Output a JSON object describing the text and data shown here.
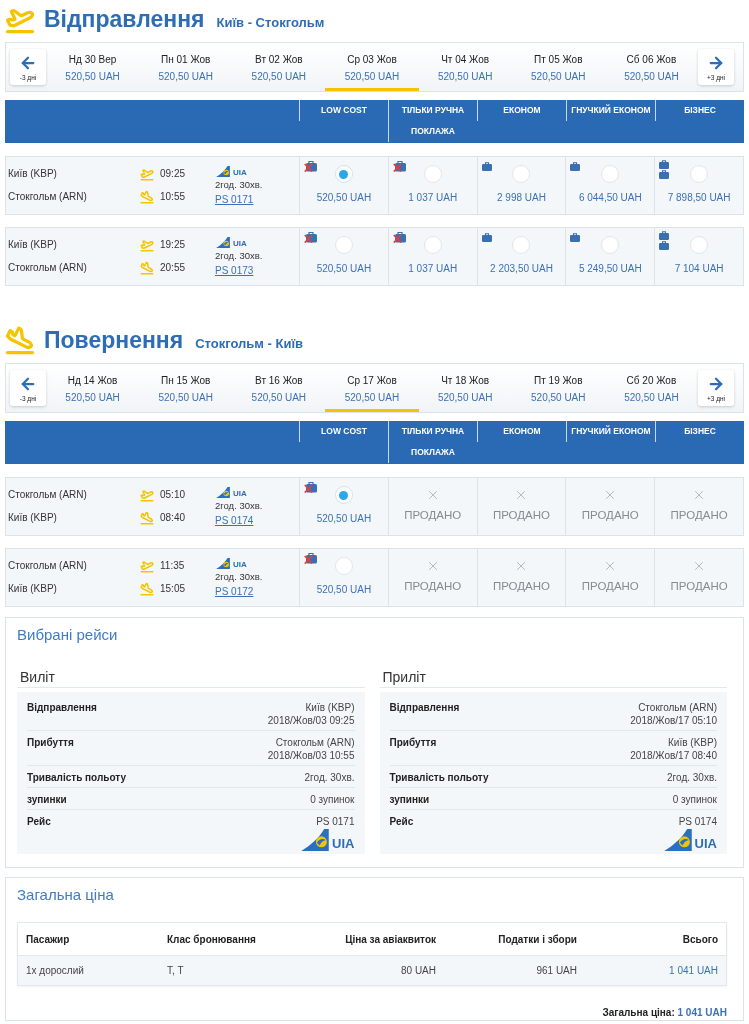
{
  "legs": [
    {
      "kind": "departure",
      "title": "Відправлення",
      "route": "Київ - Стокгольм",
      "date_nav": {
        "prev_label": "-3 дні",
        "next_label": "+3 дні",
        "days": [
          {
            "day": "Нд 30 Вер",
            "price": "520,50 UAH",
            "selected": false
          },
          {
            "day": "Пн 01 Жов",
            "price": "520,50 UAH",
            "selected": false
          },
          {
            "day": "Вт 02 Жов",
            "price": "520,50 UAH",
            "selected": false
          },
          {
            "day": "Ср 03 Жов",
            "price": "520,50 UAH",
            "selected": true
          },
          {
            "day": "Чт 04 Жов",
            "price": "520,50 UAH",
            "selected": false
          },
          {
            "day": "Пт 05 Жов",
            "price": "520,50 UAH",
            "selected": false
          },
          {
            "day": "Сб 06 Жов",
            "price": "520,50 UAH",
            "selected": false
          }
        ]
      },
      "fare_columns": [
        "LOW COST",
        "ТІЛЬКИ РУЧНА ПОКЛАЖА",
        "ЕКОНОМ",
        "ГНУЧКИЙ ЕКОНОМ",
        "БІЗНЕС"
      ],
      "flights": [
        {
          "from": "Київ (KBP)",
          "departure_time": "09:25",
          "to": "Стокгольм (ARN)",
          "arrival_time": "10:55",
          "airline": "UIA",
          "duration": "2год. 30хв.",
          "flight_number": "PS 0171",
          "fares": [
            {
              "kind": "no_bag",
              "price": "520,50 UAH",
              "selected": true
            },
            {
              "kind": "no_bag",
              "price": "1 037 UAH",
              "selected": false
            },
            {
              "kind": "one_bag",
              "price": "2 998 UAH",
              "selected": false
            },
            {
              "kind": "one_bag",
              "price": "6 044,50 UAH",
              "selected": false
            },
            {
              "kind": "two_bags",
              "price": "7 898,50 UAH",
              "selected": false
            }
          ]
        },
        {
          "from": "Київ (KBP)",
          "departure_time": "19:25",
          "to": "Стокгольм (ARN)",
          "arrival_time": "20:55",
          "airline": "UIA",
          "duration": "2год. 30хв.",
          "flight_number": "PS 0173",
          "fares": [
            {
              "kind": "no_bag",
              "price": "520,50 UAH",
              "selected": false
            },
            {
              "kind": "no_bag",
              "price": "1 037 UAH",
              "selected": false
            },
            {
              "kind": "one_bag",
              "price": "2 203,50 UAH",
              "selected": false
            },
            {
              "kind": "one_bag",
              "price": "5 249,50 UAH",
              "selected": false
            },
            {
              "kind": "two_bags",
              "price": "7 104 UAH",
              "selected": false
            }
          ]
        }
      ]
    },
    {
      "kind": "return",
      "title": "Повернення",
      "route": "Стокгольм - Київ",
      "date_nav": {
        "prev_label": "-3 дні",
        "next_label": "+3 дні",
        "days": [
          {
            "day": "Нд 14 Жов",
            "price": "520,50 UAH",
            "selected": false
          },
          {
            "day": "Пн 15 Жов",
            "price": "520,50 UAH",
            "selected": false
          },
          {
            "day": "Вт 16 Жов",
            "price": "520,50 UAH",
            "selected": false
          },
          {
            "day": "Ср 17 Жов",
            "price": "520,50 UAH",
            "selected": true
          },
          {
            "day": "Чт 18 Жов",
            "price": "520,50 UAH",
            "selected": false
          },
          {
            "day": "Пт 19 Жов",
            "price": "520,50 UAH",
            "selected": false
          },
          {
            "day": "Сб 20 Жов",
            "price": "520,50 UAH",
            "selected": false
          }
        ]
      },
      "fare_columns": [
        "LOW COST",
        "ТІЛЬКИ РУЧНА ПОКЛАЖА",
        "ЕКОНОМ",
        "ГНУЧКИЙ ЕКОНОМ",
        "БІЗНЕС"
      ],
      "flights": [
        {
          "from": "Стокгольм (ARN)",
          "departure_time": "05:10",
          "to": "Київ (KBP)",
          "arrival_time": "08:40",
          "airline": "UIA",
          "duration": "2год. 30хв.",
          "flight_number": "PS 0174",
          "fares": [
            {
              "kind": "no_bag",
              "price": "520,50 UAH",
              "selected": true
            },
            {
              "kind": "sold_out",
              "label": "ПРОДАНО"
            },
            {
              "kind": "sold_out",
              "label": "ПРОДАНО"
            },
            {
              "kind": "sold_out",
              "label": "ПРОДАНО"
            },
            {
              "kind": "sold_out",
              "label": "ПРОДАНО"
            }
          ]
        },
        {
          "from": "Стокгольм (ARN)",
          "departure_time": "11:35",
          "to": "Київ (KBP)",
          "arrival_time": "15:05",
          "airline": "UIA",
          "duration": "2год. 30хв.",
          "flight_number": "PS 0172",
          "fares": [
            {
              "kind": "no_bag",
              "price": "520,50 UAH",
              "selected": false
            },
            {
              "kind": "sold_out",
              "label": "ПРОДАНО"
            },
            {
              "kind": "sold_out",
              "label": "ПРОДАНО"
            },
            {
              "kind": "sold_out",
              "label": "ПРОДАНО"
            },
            {
              "kind": "sold_out",
              "label": "ПРОДАНО"
            }
          ]
        }
      ]
    }
  ],
  "selected_flights": {
    "title": "Вибрані рейси",
    "cards": [
      {
        "heading": "Виліт",
        "rows": [
          {
            "kind": "place",
            "label": "Відправлення",
            "place": "Київ (KBP)",
            "time": "2018/Жов/03 09:25"
          },
          {
            "kind": "place",
            "label": "Прибуття",
            "place": "Стокгольм (ARN)",
            "time": "2018/Жов/03 10:55"
          },
          {
            "kind": "text",
            "label": "Тривалість польоту",
            "value": "2год. 30хв."
          },
          {
            "kind": "text",
            "label": "зупинки",
            "value": "0 зупинок"
          },
          {
            "kind": "flight",
            "label": "Рейс",
            "value": "PS 0171",
            "airline": "UIA"
          }
        ]
      },
      {
        "heading": "Приліт",
        "rows": [
          {
            "kind": "place",
            "label": "Відправлення",
            "place": "Стокгольм (ARN)",
            "time": "2018/Жов/17 05:10"
          },
          {
            "kind": "place",
            "label": "Прибуття",
            "place": "Київ (KBP)",
            "time": "2018/Жов/17 08:40"
          },
          {
            "kind": "text",
            "label": "Тривалість польоту",
            "value": "2год. 30хв."
          },
          {
            "kind": "text",
            "label": "зупинки",
            "value": "0 зупинок"
          },
          {
            "kind": "flight",
            "label": "Рейс",
            "value": "PS 0174",
            "airline": "UIA"
          }
        ]
      }
    ]
  },
  "total_price": {
    "title": "Загальна ціна",
    "columns": [
      "Пасажир",
      "Клас бронювання",
      "Ціна за авіаквиток",
      "Податки і збори",
      "Всього"
    ],
    "rows": [
      [
        "1x дорослий",
        "T, T",
        "80 UAH",
        "961 UAH",
        "1 041 UAH"
      ]
    ],
    "summary_label": "Загальна ціна:",
    "summary_value": "1 041 UAH"
  }
}
